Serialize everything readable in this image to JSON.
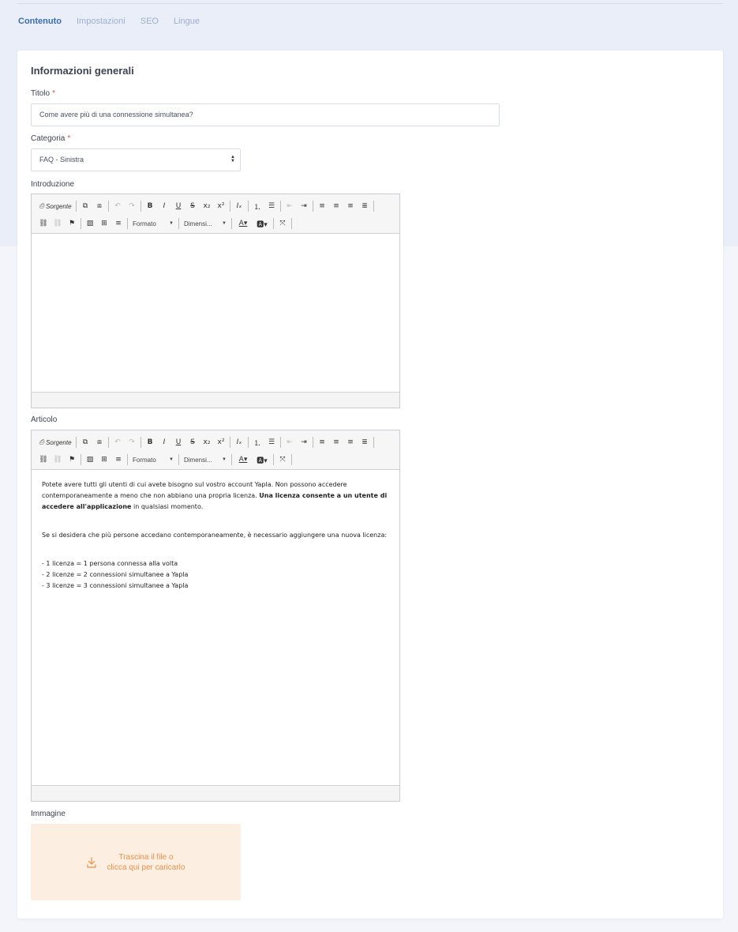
{
  "tabs": [
    {
      "label": "Contenuto",
      "active": true
    },
    {
      "label": "Impostazioni",
      "active": false
    },
    {
      "label": "SEO",
      "active": false
    },
    {
      "label": "Lingue",
      "active": false
    }
  ],
  "section": {
    "title": "Informazioni generali"
  },
  "fields": {
    "titolo": {
      "label": "Titolo",
      "required_mark": "*",
      "value": "Come avere più di una connessione simultanea?"
    },
    "categoria": {
      "label": "Categoria",
      "required_mark": "*",
      "value": "FAQ - Sinistra"
    },
    "introduzione": {
      "label": "Introduzione"
    },
    "articolo": {
      "label": "Articolo"
    },
    "immagine": {
      "label": "Immagine"
    }
  },
  "editor_toolbar": {
    "source_label": "Sorgente",
    "format_label": "Formato",
    "size_label": "Dimensi..."
  },
  "article_body": {
    "p1_start": "Potete avere tutti gli utenti di cui avete bisogno sul vostro account Yapla. Non possono accedere contemporaneamente a meno che non abbiano una propria licenza. ",
    "p1_bold": "Una licenza consente a un utente di accedere all'applicazione",
    "p1_end": " in qualsiasi momento.",
    "p2": "Se si desidera che più persone accedano contemporaneamente, è necessario aggiungere una nuova licenza:",
    "list": [
      "- 1 licenza = 1 persona connessa alla volta",
      "- 2 licenze = 2 connessioni simultanee a Yapla",
      "- 3 licenze = 3 connessioni simultanee a Yapla"
    ]
  },
  "dropzone": {
    "line1": "Trascina il file o",
    "line2": "clicca qui per caricarlo",
    "icon": "download-icon"
  },
  "colors": {
    "accent": "#3a6db0",
    "tab_inactive": "#9fb0cc",
    "required": "#e0564b",
    "dropzone_bg": "#fdeee2",
    "dropzone_text": "#e8904a"
  }
}
